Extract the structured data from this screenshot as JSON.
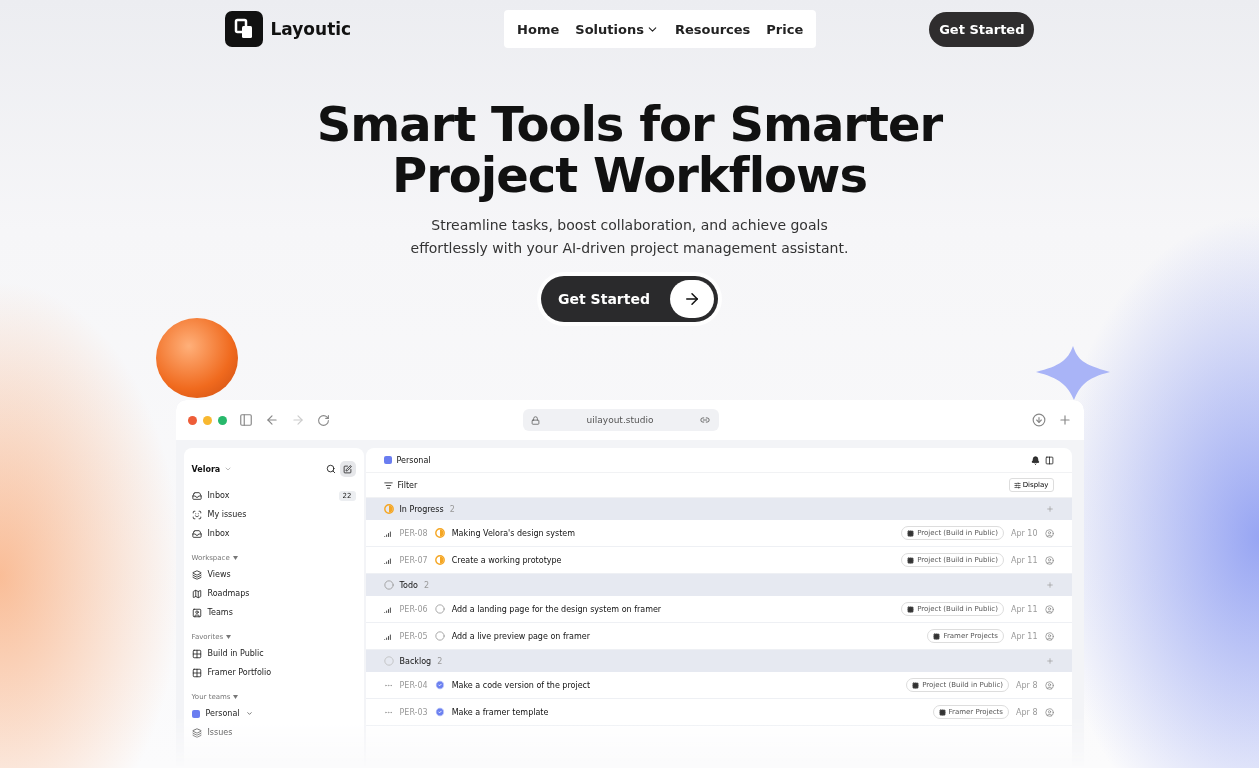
{
  "nav": {
    "brand": "Layoutic",
    "links": [
      {
        "label": "Home",
        "dropdown": false
      },
      {
        "label": "Solutions",
        "dropdown": true
      },
      {
        "label": "Resources",
        "dropdown": false
      },
      {
        "label": "Price",
        "dropdown": false
      }
    ],
    "cta": "Get Started"
  },
  "hero": {
    "title": "Smart Tools for Smarter Project Workflows",
    "subtitle": "Streamline tasks, boost collaboration, and achieve goals effortlessly with your AI-driven project management assistant.",
    "cta": "Get Started"
  },
  "browser": {
    "url": "uilayout.studio"
  },
  "app": {
    "workspace": "Velora",
    "sidebar": [
      {
        "kind": "item",
        "label": "Inbox",
        "count": "22"
      },
      {
        "kind": "item",
        "label": "My issues"
      },
      {
        "kind": "item",
        "label": "Inbox"
      },
      {
        "kind": "section",
        "label": "Workspace"
      },
      {
        "kind": "item",
        "label": "Views"
      },
      {
        "kind": "item",
        "label": "Roadmaps"
      },
      {
        "kind": "item",
        "label": "Teams"
      },
      {
        "kind": "section",
        "label": "Favorites"
      },
      {
        "kind": "item",
        "label": "Build in Public"
      },
      {
        "kind": "item",
        "label": "Framer Portfolio"
      },
      {
        "kind": "section",
        "label": "Your teams"
      },
      {
        "kind": "item",
        "label": "Personal",
        "dropdown": true
      },
      {
        "kind": "item",
        "label": "Issues"
      }
    ],
    "team": "Personal",
    "filter": "Filter",
    "display": "Display",
    "groups": [
      {
        "kind": "in_progress",
        "label": "In Progress",
        "count": "2",
        "issues": [
          {
            "id": "PER-08",
            "kind": "in_progress",
            "title": "Making Velora's design system",
            "project": "Project (Build in Public)",
            "date": "Apr 10"
          },
          {
            "id": "PER-07",
            "kind": "in_progress",
            "title": "Create a working prototype",
            "project": "Project (Build in Public)",
            "date": "Apr 11"
          }
        ]
      },
      {
        "kind": "todo",
        "label": "Todo",
        "count": "2",
        "issues": [
          {
            "id": "PER-06",
            "kind": "todo",
            "title": "Add a landing page for the design system on framer",
            "project": "Project (Build in Public)",
            "date": "Apr 11"
          },
          {
            "id": "PER-05",
            "kind": "todo",
            "title": "Add a live preview page on framer",
            "project": "Framer Projects",
            "date": "Apr 11"
          }
        ]
      },
      {
        "kind": "backlog",
        "label": "Backlog",
        "count": "2",
        "issues": [
          {
            "id": "PER-04",
            "kind": "done",
            "title": "Make a code version of the project",
            "project": "Project (Build in Public)",
            "date": "Apr 8"
          },
          {
            "id": "PER-03",
            "kind": "done",
            "title": "Make a framer template",
            "project": "Framer Projects",
            "date": "Apr 8"
          }
        ]
      }
    ]
  }
}
